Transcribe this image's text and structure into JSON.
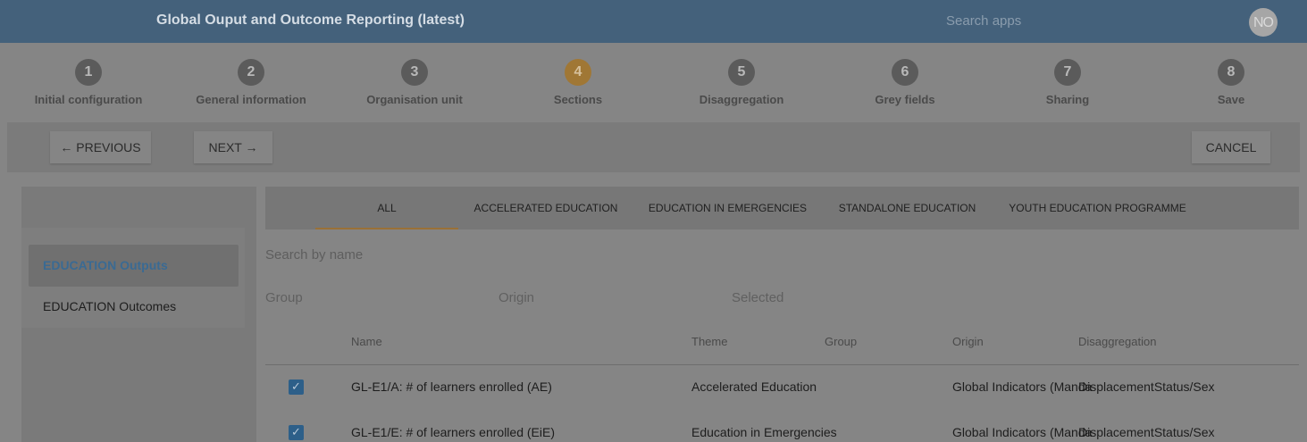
{
  "appbar": {
    "title": "Global Ouput and Outcome Reporting (latest)",
    "search_placeholder": "Search apps",
    "avatar_initials": "NO"
  },
  "stepper": {
    "active_step": 4,
    "steps": [
      {
        "number": "1",
        "label": "Initial configuration"
      },
      {
        "number": "2",
        "label": "General information"
      },
      {
        "number": "3",
        "label": "Organisation unit"
      },
      {
        "number": "4",
        "label": "Sections"
      },
      {
        "number": "5",
        "label": "Disaggregation"
      },
      {
        "number": "6",
        "label": "Grey fields"
      },
      {
        "number": "7",
        "label": "Sharing"
      },
      {
        "number": "8",
        "label": "Save"
      }
    ]
  },
  "nav": {
    "previous_label": "← PREVIOUS",
    "next_label": "NEXT →",
    "cancel_label": "CANCEL"
  },
  "sidebar": {
    "items": [
      {
        "label": "EDUCATION Outputs",
        "selected": true
      },
      {
        "label": "EDUCATION Outcomes",
        "selected": false
      }
    ]
  },
  "tabs": [
    {
      "label": "ALL",
      "active": true
    },
    {
      "label": "ACCELERATED EDUCATION",
      "active": false
    },
    {
      "label": "EDUCATION IN EMERGENCIES",
      "active": false
    },
    {
      "label": "STANDALONE EDUCATION",
      "active": false
    },
    {
      "label": "YOUTH EDUCATION PROGRAMME",
      "active": false
    }
  ],
  "search": {
    "placeholder": "Search by name"
  },
  "filters": {
    "group": "Group",
    "origin": "Origin",
    "selected": "Selected"
  },
  "table": {
    "columns": [
      "Name",
      "Theme",
      "Group",
      "Origin",
      "Disaggregation"
    ],
    "rows": [
      {
        "checked": true,
        "name": "GL-E1/A: # of learners enrolled (AE)",
        "theme": "Accelerated Education",
        "group": "",
        "origin": "Global Indicators (Manda",
        "disaggregation": "DisplacementStatus/Sex"
      },
      {
        "checked": true,
        "name": "GL-E1/E: # of learners enrolled (EiE)",
        "theme": "Education in Emergencies",
        "group": "",
        "origin": "Global Indicators (Manda",
        "disaggregation": "DisplacementStatus/Sex"
      }
    ]
  },
  "colors": {
    "header": "#44617b",
    "active_step": "#a07735",
    "selected_text": "#3a6a93",
    "checkbox": "#2d5f89"
  }
}
